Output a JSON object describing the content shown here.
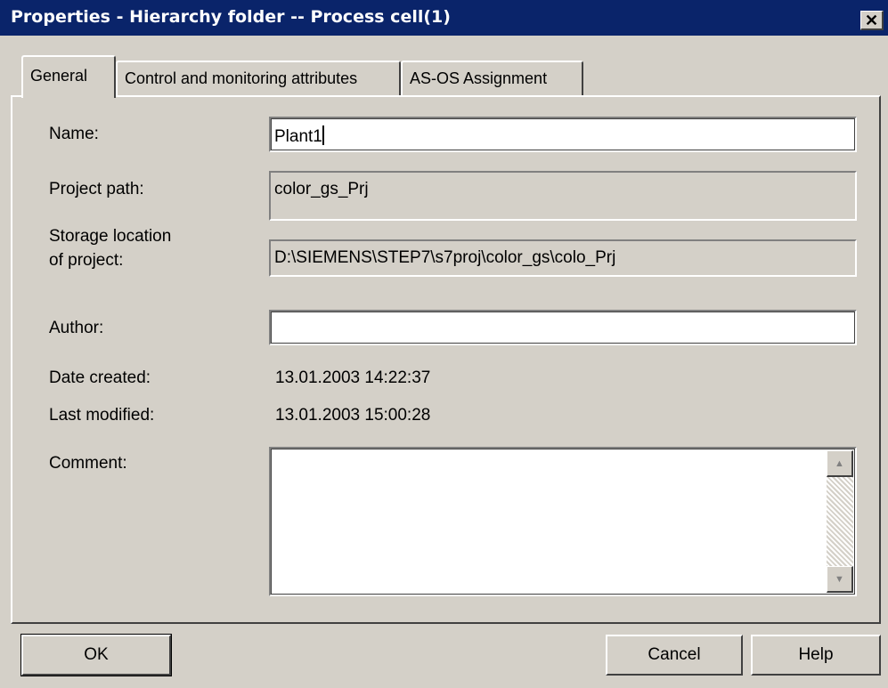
{
  "window": {
    "title": "Properties - Hierarchy folder -- Process cell(1)",
    "close_glyph": "✕"
  },
  "tabs": [
    "General",
    "Control and monitoring attributes",
    "AS-OS Assignment"
  ],
  "form": {
    "name_label": "Name:",
    "name_value": "Plant1",
    "project_path_label": "Project path:",
    "project_path_value": "color_gs_Prj",
    "storage_label_line1": "Storage location",
    "storage_label_line2": "of project:",
    "storage_value": "D:\\SIEMENS\\STEP7\\s7proj\\color_gs\\colo_Prj",
    "author_label": "Author:",
    "author_value": "",
    "date_created_label": "Date created:",
    "date_created_value": "13.01.2003 14:22:37",
    "last_modified_label": "Last modified:",
    "last_modified_value": "13.01.2003 15:00:28",
    "comment_label": "Comment:",
    "comment_value": ""
  },
  "buttons": {
    "ok": "OK",
    "cancel": "Cancel",
    "help": "Help"
  },
  "icons": {
    "scroll_up": "▲",
    "scroll_down": "▼"
  }
}
